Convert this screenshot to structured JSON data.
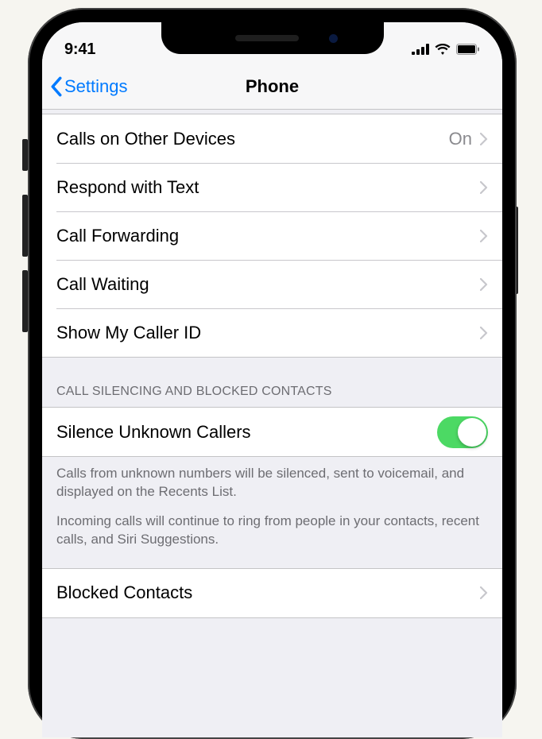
{
  "statusBar": {
    "time": "9:41"
  },
  "nav": {
    "back": "Settings",
    "title": "Phone"
  },
  "cells": {
    "callsOnOtherDevices": {
      "label": "Calls on Other Devices",
      "value": "On"
    },
    "respondWithText": {
      "label": "Respond with Text"
    },
    "callForwarding": {
      "label": "Call Forwarding"
    },
    "callWaiting": {
      "label": "Call Waiting"
    },
    "showMyCallerId": {
      "label": "Show My Caller ID"
    },
    "silenceUnknown": {
      "label": "Silence Unknown Callers",
      "enabled": true
    },
    "blockedContacts": {
      "label": "Blocked Contacts"
    }
  },
  "sections": {
    "silencingHeader": "CALL SILENCING AND BLOCKED CONTACTS",
    "silencingFooter1": "Calls from unknown numbers will be silenced, sent to voicemail, and displayed on the Recents List.",
    "silencingFooter2": "Incoming calls will continue to ring from people in your contacts, recent calls, and Siri Suggestions."
  }
}
